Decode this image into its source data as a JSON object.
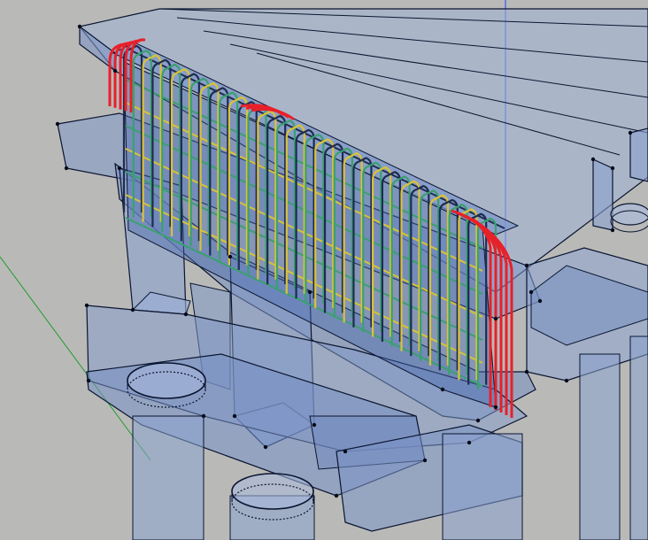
{
  "viewport": {
    "background": "#b9bab8",
    "model_fill": "#6f8fc8",
    "model_fill_dark": "#3f5f9c",
    "edge_color": "#0b1530",
    "vertex_color": "#050a18"
  },
  "axes": {
    "blue_axis_color": "#2c3cff",
    "green_axis_color": "#1f9a2a"
  },
  "rebar": {
    "stirrup_color": "#e8202a",
    "longitudinal_color": "#d8c23a",
    "link_color": "#3aa070",
    "dark_bar_color": "#1e2c50"
  }
}
